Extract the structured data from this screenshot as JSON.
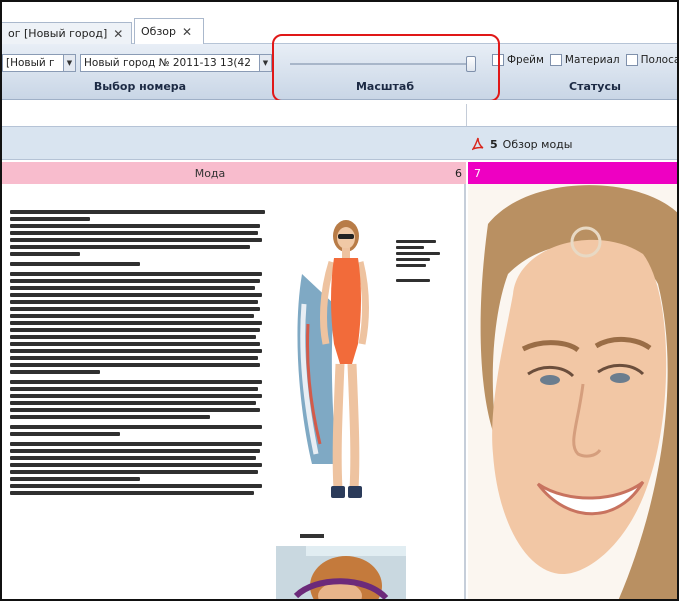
{
  "tabs": [
    {
      "label": "ог [Новый город]",
      "active": false
    },
    {
      "label": "Обзор",
      "active": true
    }
  ],
  "toolbar": {
    "select_1": "[Новый г",
    "select_2": "Новый город № 2011-13 13(42",
    "labels": {
      "number": "Выбор номера",
      "scale": "Масштаб",
      "statuses": "Статусы"
    },
    "checkboxes": [
      "Фрейм",
      "Материал",
      "Полоса"
    ]
  },
  "document": {
    "number": "5",
    "title": "Обзор моды"
  },
  "pages": {
    "left": {
      "section": "Мода",
      "number": "6"
    },
    "right": {
      "number": "7"
    }
  },
  "colors": {
    "accent_pink": "#f8bccd",
    "accent_magenta": "#ee00c2",
    "highlight_red": "#e01818",
    "toolbar_blue": "#c9d6e6"
  },
  "icons": [
    "dropdown-arrow-icon",
    "pdf-icon",
    "close-icon"
  ]
}
